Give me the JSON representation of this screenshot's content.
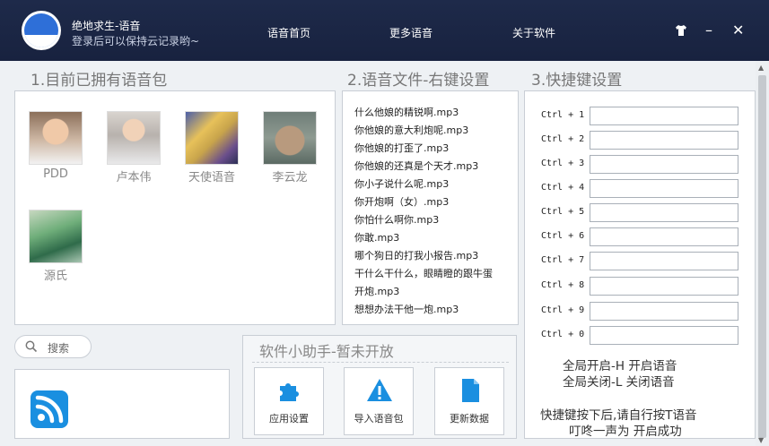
{
  "header": {
    "title": "绝地求生-语音",
    "subtitle": "登录后可以保持云记录哟~",
    "nav": [
      "语音首页",
      "更多语音",
      "关于软件"
    ],
    "controls": {
      "skin": "shirt-icon",
      "minimize": "–",
      "close": "✕"
    }
  },
  "sections": {
    "packs_title": "1.目前已拥有语音包",
    "files_title": "2.语音文件-右键设置",
    "hotkeys_title": "3.快捷键设置",
    "helper_title": "软件小助手-暂未开放"
  },
  "packs": [
    {
      "name": "PDD"
    },
    {
      "name": "卢本伟"
    },
    {
      "name": "天使语音"
    },
    {
      "name": "李云龙"
    },
    {
      "name": "源氏"
    }
  ],
  "files": [
    "什么他娘的精锐啊.mp3",
    "你他娘的意大利炮呢.mp3",
    "你他娘的打歪了.mp3",
    "你他娘的还真是个天才.mp3",
    "你小子说什么呢.mp3",
    "你开炮啊（女）.mp3",
    "你怕什么啊你.mp3",
    "你敢.mp3",
    "哪个狗日的打我小报告.mp3",
    "干什么干什么，眼睛瞪的跟牛蛋",
    "开炮.mp3",
    "想想办法干他一炮.mp3"
  ],
  "hotkeys": [
    {
      "label": "Ctrl + 1",
      "value": ""
    },
    {
      "label": "Ctrl + 2",
      "value": ""
    },
    {
      "label": "Ctrl + 3",
      "value": ""
    },
    {
      "label": "Ctrl + 4",
      "value": ""
    },
    {
      "label": "Ctrl + 5",
      "value": ""
    },
    {
      "label": "Ctrl + 6",
      "value": ""
    },
    {
      "label": "Ctrl + 7",
      "value": ""
    },
    {
      "label": "Ctrl + 8",
      "value": ""
    },
    {
      "label": "Ctrl + 9",
      "value": ""
    },
    {
      "label": "Ctrl + 0",
      "value": ""
    }
  ],
  "hotkey_notes": {
    "line1": "全局开启-H   开启语音",
    "line2": "全局关闭-L   关闭语音",
    "line3": "快捷键按下后,请自行按T语音",
    "line4": "叮咚一声为 开启成功"
  },
  "search": {
    "placeholder": "搜索"
  },
  "helper_buttons": [
    {
      "label": "应用设置",
      "icon": "puzzle-icon"
    },
    {
      "label": "导入语音包",
      "icon": "warning-icon"
    },
    {
      "label": "更新数据",
      "icon": "document-icon"
    }
  ],
  "colors": {
    "header_bg": "#1e2a4a",
    "accent_blue": "#1a8fe0"
  }
}
